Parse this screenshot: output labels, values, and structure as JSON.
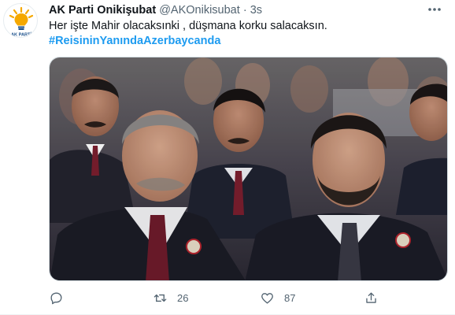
{
  "account": {
    "display_name": "AK Parti Onikişubat",
    "handle": "@AKOnikisubat",
    "separator": "·",
    "time": "3s",
    "avatar_caption": "AK PARTİ"
  },
  "tweet": {
    "text": "Her işte Mahir olacaksınki , düşmana korku salacaksın.",
    "hashtag": "#ReisininYanındaAzerbaycanda"
  },
  "actions": {
    "reply_count": "",
    "retweet_count": "26",
    "like_count": "87"
  },
  "icons": {
    "more": "more-horizontal-icon",
    "reply": "reply-icon",
    "retweet": "retweet-icon",
    "like": "like-icon",
    "share": "share-icon"
  },
  "colors": {
    "accent": "#1d9bf0",
    "muted": "#536471",
    "text": "#0f1419",
    "logo_yellow": "#f5a800",
    "logo_blue": "#1a4f8b"
  }
}
